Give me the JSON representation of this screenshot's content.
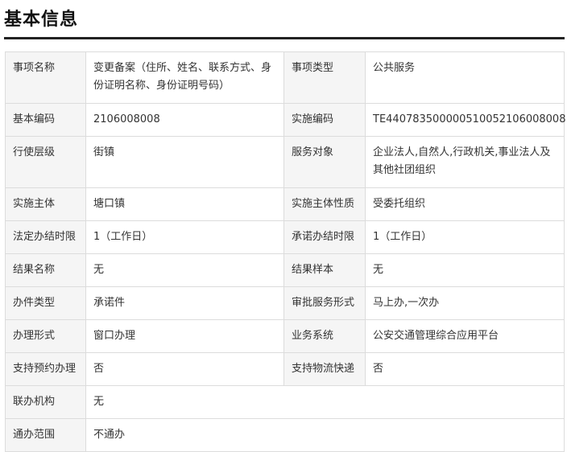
{
  "section_title": "基本信息",
  "rows": [
    {
      "l1": "事项名称",
      "v1": "变更备案（住所、姓名、联系方式、身份证明名称、身份证明号码）",
      "l2": "事项类型",
      "v2": "公共服务"
    },
    {
      "l1": "基本编码",
      "v1": "2106008008",
      "l2": "实施编码",
      "v2": "TE440783500000510052106008008"
    },
    {
      "l1": "行使层级",
      "v1": "街镇",
      "l2": "服务对象",
      "v2": "企业法人,自然人,行政机关,事业法人及其他社团组织"
    },
    {
      "l1": "实施主体",
      "v1": "塘口镇",
      "l2": "实施主体性质",
      "v2": "受委托组织"
    },
    {
      "l1": "法定办结时限",
      "v1": "1（工作日）",
      "l2": "承诺办结时限",
      "v2": "1（工作日）"
    },
    {
      "l1": "结果名称",
      "v1": "无",
      "l2": "结果样本",
      "v2": "无"
    },
    {
      "l1": "办件类型",
      "v1": "承诺件",
      "l2": "审批服务形式",
      "v2": "马上办,一次办"
    },
    {
      "l1": "办理形式",
      "v1": "窗口办理",
      "l2": "业务系统",
      "v2": "公安交通管理综合应用平台"
    },
    {
      "l1": "支持预约办理",
      "v1": "否",
      "l2": "支持物流快递",
      "v2": "否"
    },
    {
      "l1": "联办机构",
      "v1": "无"
    },
    {
      "l1": "通办范围",
      "v1": "不通办"
    }
  ]
}
